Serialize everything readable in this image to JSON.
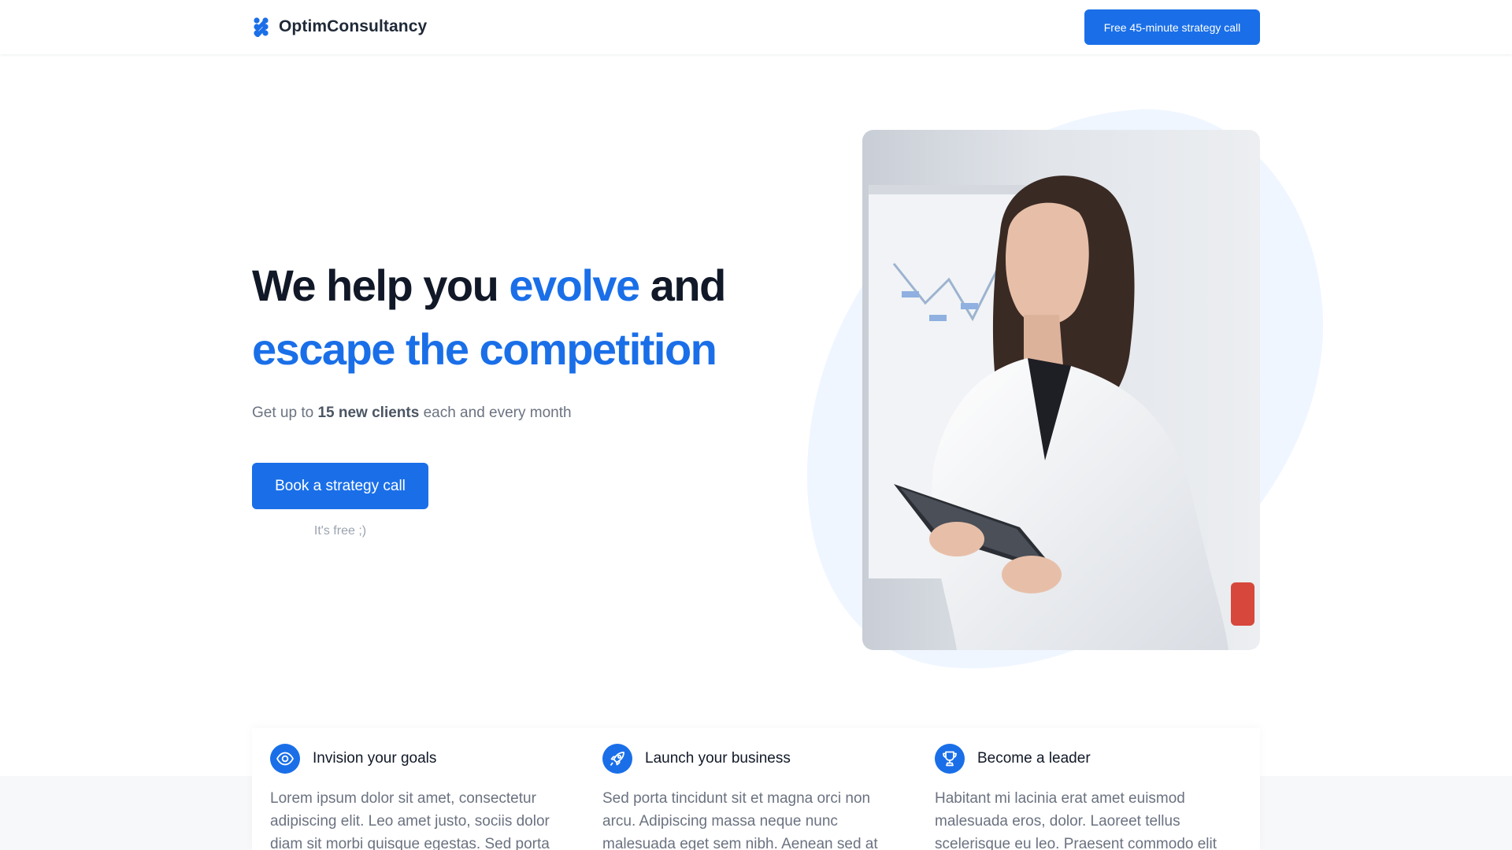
{
  "header": {
    "brand": "OptimConsultancy",
    "cta_label": "Free 45-minute strategy call"
  },
  "hero": {
    "title_part1": "We help you ",
    "title_highlight1": "evolve",
    "title_part2": " and",
    "title_highlight2": "escape the competition",
    "subtitle_prefix": "Get up to ",
    "subtitle_bold": "15 new clients",
    "subtitle_suffix": " each and every month",
    "cta_label": "Book a strategy call",
    "cta_note": "It's free ;)"
  },
  "features": [
    {
      "icon": "eye-icon",
      "title": "Invision your goals",
      "desc": "Lorem ipsum dolor sit amet, consectetur adipiscing elit. Leo amet justo, sociis dolor diam sit morbi quisque egestas. Sed porta"
    },
    {
      "icon": "rocket-icon",
      "title": "Launch your business",
      "desc": "Sed porta tincidunt sit et magna orci non arcu. Adipiscing massa neque nunc malesuada eget sem nibh. Aenean sed at"
    },
    {
      "icon": "trophy-icon",
      "title": "Become a leader",
      "desc": "Habitant mi lacinia erat amet euismod malesuada eros, dolor. Laoreet tellus scelerisque eu leo. Praesent commodo elit in"
    }
  ],
  "colors": {
    "accent": "#1a6fe8",
    "text_dark": "#111827",
    "text_muted": "#6b7280",
    "blob": "#eff6ff"
  }
}
